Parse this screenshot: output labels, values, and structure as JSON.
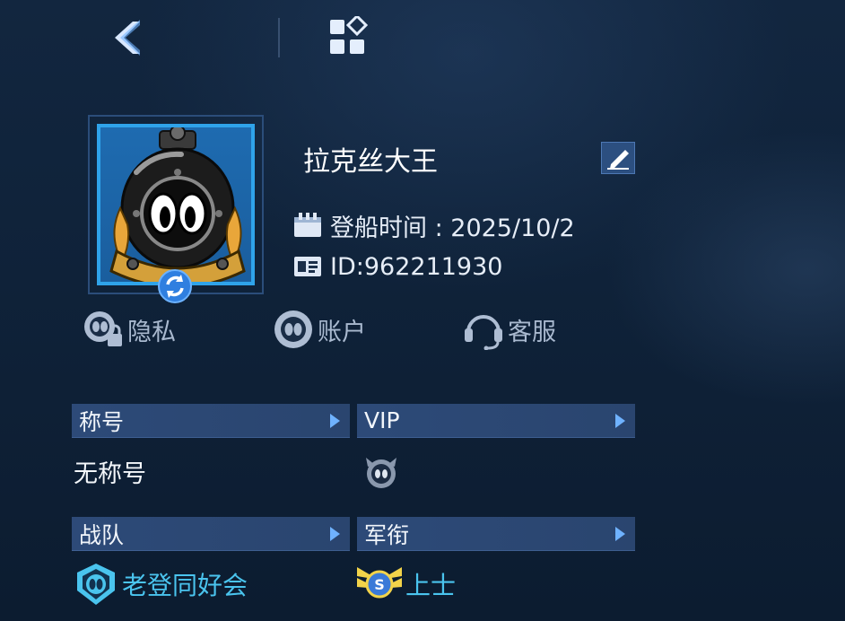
{
  "colors": {
    "background": "#0f2239",
    "accent_blue": "#2fa3ea",
    "section_header": "#2d4a78",
    "link_cyan": "#4ac4ee",
    "muted_label": "#a9b9cf"
  },
  "topbar": {
    "back_icon": "back-chevron-icon",
    "apps_icon": "apps-grid-icon"
  },
  "profile": {
    "username": "拉克丝大王",
    "join_date": "登船时间 : 2025/10/2",
    "id": "ID:962211930",
    "avatar": "diving-helmet-avatar",
    "edit_icon": "edit-pencil-icon",
    "refresh_icon": "refresh-icon"
  },
  "actions": [
    {
      "label": "隐私",
      "icon": "privacy-lock-icon"
    },
    {
      "label": "账户",
      "icon": "account-icon"
    },
    {
      "label": "客服",
      "icon": "headset-icon"
    }
  ],
  "sections": {
    "title": {
      "header": "称号",
      "value": "无称号"
    },
    "vip": {
      "header": "VIP",
      "value_icon": "vip-robot-icon"
    },
    "team": {
      "header": "战队",
      "value": "老登同好会",
      "icon": "team-emblem-icon"
    },
    "rank": {
      "header": "军衔",
      "value": "上士",
      "icon": "rank-badge-icon"
    }
  }
}
